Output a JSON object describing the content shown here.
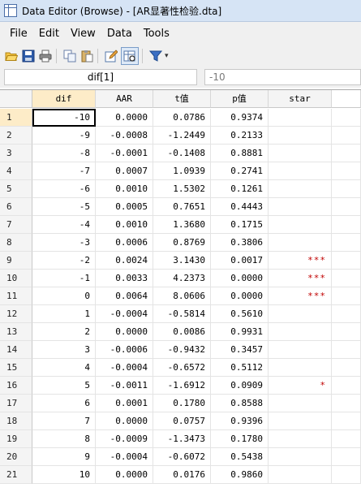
{
  "window": {
    "title": "Data Editor (Browse) - [AR显著性检验.dta]"
  },
  "menu": [
    "File",
    "Edit",
    "View",
    "Data",
    "Tools"
  ],
  "toolbar": {
    "icons": [
      "open-icon",
      "save-icon",
      "print-icon",
      "copy-icon",
      "paste-icon",
      "edit-icon",
      "browse-icon",
      "filter-icon"
    ]
  },
  "refbar": {
    "cell_ref": "dif[1]",
    "cell_value": "-10"
  },
  "columns": [
    "dif",
    "AAR",
    "t值",
    "p值",
    "star"
  ],
  "rows": [
    {
      "n": "1",
      "dif": "-10",
      "aar": "0.0000",
      "t": "0.0786",
      "p": "0.9374",
      "star": ""
    },
    {
      "n": "2",
      "dif": "-9",
      "aar": "-0.0008",
      "t": "-1.2449",
      "p": "0.2133",
      "star": ""
    },
    {
      "n": "3",
      "dif": "-8",
      "aar": "-0.0001",
      "t": "-0.1408",
      "p": "0.8881",
      "star": ""
    },
    {
      "n": "4",
      "dif": "-7",
      "aar": "0.0007",
      "t": "1.0939",
      "p": "0.2741",
      "star": ""
    },
    {
      "n": "5",
      "dif": "-6",
      "aar": "0.0010",
      "t": "1.5302",
      "p": "0.1261",
      "star": ""
    },
    {
      "n": "6",
      "dif": "-5",
      "aar": "0.0005",
      "t": "0.7651",
      "p": "0.4443",
      "star": ""
    },
    {
      "n": "7",
      "dif": "-4",
      "aar": "0.0010",
      "t": "1.3680",
      "p": "0.1715",
      "star": ""
    },
    {
      "n": "8",
      "dif": "-3",
      "aar": "0.0006",
      "t": "0.8769",
      "p": "0.3806",
      "star": ""
    },
    {
      "n": "9",
      "dif": "-2",
      "aar": "0.0024",
      "t": "3.1430",
      "p": "0.0017",
      "star": "***"
    },
    {
      "n": "10",
      "dif": "-1",
      "aar": "0.0033",
      "t": "4.2373",
      "p": "0.0000",
      "star": "***"
    },
    {
      "n": "11",
      "dif": "0",
      "aar": "0.0064",
      "t": "8.0606",
      "p": "0.0000",
      "star": "***"
    },
    {
      "n": "12",
      "dif": "1",
      "aar": "-0.0004",
      "t": "-0.5814",
      "p": "0.5610",
      "star": ""
    },
    {
      "n": "13",
      "dif": "2",
      "aar": "0.0000",
      "t": "0.0086",
      "p": "0.9931",
      "star": ""
    },
    {
      "n": "14",
      "dif": "3",
      "aar": "-0.0006",
      "t": "-0.9432",
      "p": "0.3457",
      "star": ""
    },
    {
      "n": "15",
      "dif": "4",
      "aar": "-0.0004",
      "t": "-0.6572",
      "p": "0.5112",
      "star": ""
    },
    {
      "n": "16",
      "dif": "5",
      "aar": "-0.0011",
      "t": "-1.6912",
      "p": "0.0909",
      "star": "*"
    },
    {
      "n": "17",
      "dif": "6",
      "aar": "0.0001",
      "t": "0.1780",
      "p": "0.8588",
      "star": ""
    },
    {
      "n": "18",
      "dif": "7",
      "aar": "0.0000",
      "t": "0.0757",
      "p": "0.9396",
      "star": ""
    },
    {
      "n": "19",
      "dif": "8",
      "aar": "-0.0009",
      "t": "-1.3473",
      "p": "0.1780",
      "star": ""
    },
    {
      "n": "20",
      "dif": "9",
      "aar": "-0.0004",
      "t": "-0.6072",
      "p": "0.5438",
      "star": ""
    },
    {
      "n": "21",
      "dif": "10",
      "aar": "0.0000",
      "t": "0.0176",
      "p": "0.9860",
      "star": ""
    }
  ],
  "colors": {
    "selected_column_header": "#fdecc8",
    "star_text": "#c00000",
    "titlebar": "#d6e4f5"
  }
}
